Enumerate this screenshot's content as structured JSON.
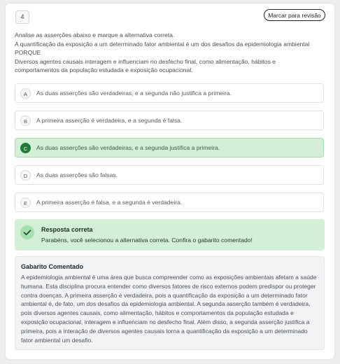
{
  "question": {
    "number": "4",
    "review_label": "Marcar para revisão",
    "statement_lines": [
      "Analise as asserções abaixo e marque a alternativa correta.",
      "A quantificação da exposição a um determinado fator ambiental é um dos desafios da epidemiologia ambiental",
      "PORQUE",
      "Diversos agentes causais interagem e influenciam no desfecho final, como alimentação, hábitos e",
      "comportamentos da população estudada e exposição ocupacional."
    ]
  },
  "options": [
    {
      "letter": "A",
      "text": "As duas asserções são verdadeiras, e a segunda não justifica a primeira."
    },
    {
      "letter": "B",
      "text": "A primeira asserção é verdadeira, e a segunda é falsa."
    },
    {
      "letter": "C",
      "text": "As duas asserções são verdadeiras, e a segunda justifica a primeira."
    },
    {
      "letter": "D",
      "text": "As duas asserções são falsas."
    },
    {
      "letter": "E",
      "text": "A primeira asserção é falsa, e a segunda é verdadeira."
    }
  ],
  "selected_option": "C",
  "result": {
    "title": "Resposta correta",
    "message": "Parabéns, você selecionou a alternativa correta. Confira o gabarito comentado!",
    "icon": "check-icon",
    "color": "#d3f0d7"
  },
  "gabarito": {
    "title": "Gabarito Comentado",
    "text": "A epidemiologia ambiental é uma área que busca compreender como as exposições ambientais afetam a saúde humana. Esta disciplina procura entender como diversos fatores de risco externos podem predispor ou proteger contra doenças. A primeira asserção é verdadeira, pois a quantificação da exposição a um determinado fator ambiental é, de fato, um dos desafios da epidemiologia ambiental. A segunda asserção também é verdadeira, pois diversos agentes causais, como alimentação, hábitos e comportamentos da população estudada e exposição ocupacional, interagem e influenciam no desfecho final. Além disso, a segunda asserção justifica a primeira, pois a interação de diversos agentes causais torna a quantificação da exposição a um determinado fator ambiental um desafio."
  }
}
